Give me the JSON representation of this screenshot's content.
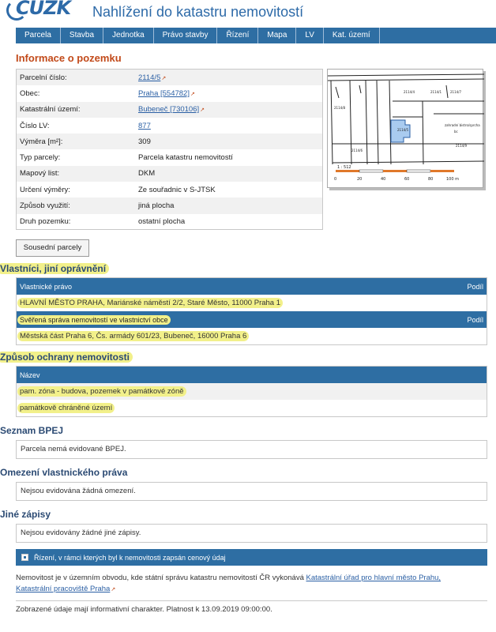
{
  "header": {
    "logo": "ČÚZK",
    "title": "Nahlížení do katastru nemovitostí"
  },
  "nav": [
    "Parcela",
    "Stavba",
    "Jednotka",
    "Právo stavby",
    "Řízení",
    "Mapa",
    "LV",
    "Kat. území"
  ],
  "parcel": {
    "heading": "Informace o pozemku",
    "rows": [
      {
        "label": "Parcelní číslo:",
        "value": "2114/5",
        "link": true
      },
      {
        "label": "Obec:",
        "value": "Praha [554782]",
        "link": true
      },
      {
        "label": "Katastrální území:",
        "value": "Bubeneč [730106]",
        "link": true
      },
      {
        "label": "Číslo LV:",
        "value": "877",
        "link": true
      },
      {
        "label": "Výměra [m²]:",
        "value": "309"
      },
      {
        "label": "Typ parcely:",
        "value": "Parcela katastru nemovitostí"
      },
      {
        "label": "Mapový list:",
        "value": "DKM"
      },
      {
        "label": "Určení výměry:",
        "value": "Ze souřadnic v S-JTSK"
      },
      {
        "label": "Způsob využití:",
        "value": "jiná plocha"
      },
      {
        "label": "Druh pozemku:",
        "value": "ostatní plocha"
      }
    ],
    "neighbors_button": "Sousední parcely"
  },
  "map": {
    "scale_label": "1 : 512",
    "scale_ticks": [
      "0",
      "20",
      "40",
      "60",
      "80",
      "100 m"
    ],
    "parcel_labels": [
      "2114/5",
      "2114/4",
      "2114/1",
      "2114/7",
      "2114/8",
      "2114/6",
      "2114/9"
    ],
    "building_label": "zahradní bistro/sprcha",
    "building_sub": "bc",
    "colors": {
      "parcel_fill": "#a9cbef",
      "scale_orange": "#e0782a"
    }
  },
  "owners": {
    "heading": "Vlastníci, jiní oprávnění",
    "col_left": "Vlastnické právo",
    "col_right": "Podíl",
    "row1": "HLAVNÍ MĚSTO PRAHA, Mariánské náměstí 2/2, Staré Město, 11000 Praha 1",
    "sub_head": "Svěřená správa nemovitostí ve vlastnictví obce",
    "sub_right": "Podíl",
    "row2": "Městská část Praha 6, Čs. armády 601/23, Bubeneč, 16000 Praha 6"
  },
  "protection": {
    "heading": "Způsob ochrany nemovitosti",
    "col": "Název",
    "rows": [
      "pam. zóna - budova, pozemek v památkové zóně",
      "památkově chráněné území"
    ]
  },
  "bpej": {
    "heading": "Seznam BPEJ",
    "text": "Parcela nemá evidované BPEJ."
  },
  "restrictions": {
    "heading": "Omezení vlastnického práva",
    "text": "Nejsou evidována žádná omezení."
  },
  "other": {
    "heading": "Jiné zápisy",
    "text": "Nejsou evidovány žádné jiné zápisy."
  },
  "proceedings_bar": "Řízení, v rámci kterých byl k nemovitosti zapsán cenový údaj",
  "footer": {
    "office_prefix": "Nemovitost je v územním obvodu, kde státní správu katastru nemovitostí ČR vykonává ",
    "office_link_1": "Katastrální úřad pro hlavní město Prahu,",
    "office_link_2": "Katastrální pracoviště Praha",
    "notice": "Zobrazené údaje mají informativní charakter. Platnost k 13.09.2019 09:00:00."
  },
  "colors": {
    "nav": "#2e6ea3",
    "heading_orange": "#c24a1a",
    "heading_blue": "#2b4a73",
    "highlight": "#f2f08a",
    "link": "#2a5fa4"
  }
}
